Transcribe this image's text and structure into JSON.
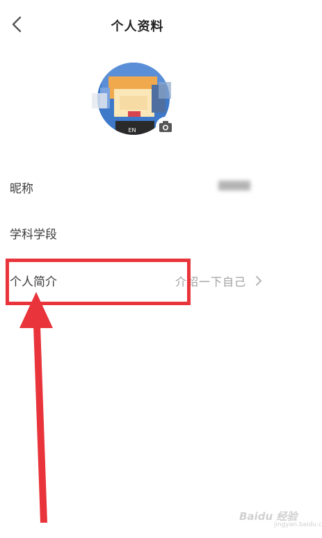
{
  "header": {
    "title": "个人资料",
    "back_icon": "chevron-left-icon"
  },
  "avatar": {
    "badge_text": "EN",
    "camera_icon": "camera-icon"
  },
  "rows": [
    {
      "label": "昵称",
      "value": ""
    },
    {
      "label": "学科学段",
      "value": ""
    },
    {
      "label": "个人简介",
      "value": "介绍一下自己",
      "chevron_icon": "chevron-right-icon"
    }
  ],
  "annotation": {
    "highlight_color": "#e8343a"
  },
  "watermark": {
    "brand": "Bai",
    "brand_accent": "du",
    "site": "经验",
    "sub": "jingyan.baidu.com"
  }
}
